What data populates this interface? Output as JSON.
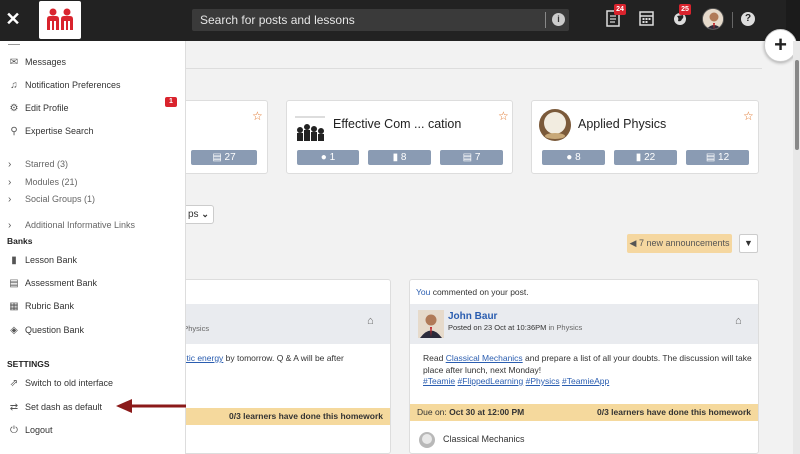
{
  "topbar": {
    "close_icon": "close-icon",
    "search_placeholder": "Search for posts and lessons",
    "notif_badge_1": "24",
    "notif_badge_2": "25",
    "help_glyph": "?"
  },
  "sidebar": {
    "items_top": [
      {
        "label": "Messages",
        "icon": "envelope-icon",
        "badge": "1"
      },
      {
        "label": "Notification Preferences",
        "icon": "bell-icon"
      },
      {
        "label": "Edit Profile",
        "icon": "gear-icon"
      },
      {
        "label": "Expertise Search",
        "icon": "search-icon"
      }
    ],
    "collapsibles": [
      {
        "label": "Starred (3)"
      },
      {
        "label": "Modules (21)"
      },
      {
        "label": "Social Groups (1)"
      },
      {
        "label": "Additional Informative Links"
      }
    ],
    "banks_heading": "Banks",
    "banks": [
      {
        "label": "Lesson Bank",
        "icon": "book-icon"
      },
      {
        "label": "Assessment Bank",
        "icon": "assessment-icon"
      },
      {
        "label": "Rubric Bank",
        "icon": "rubric-icon"
      },
      {
        "label": "Question Bank",
        "icon": "tag-icon"
      }
    ],
    "settings_heading": "SETTINGS",
    "settings": [
      {
        "label": "Switch to old interface",
        "icon": "external-link-icon"
      },
      {
        "label": "Set dash as default",
        "icon": "swap-icon"
      },
      {
        "label": "Logout",
        "icon": "power-icon"
      }
    ]
  },
  "courses": [
    {
      "title": "",
      "stats": [
        "27"
      ]
    },
    {
      "title": "Effective Com ... cation",
      "stats": [
        "1",
        "8",
        "7"
      ]
    },
    {
      "title": "Applied Physics",
      "stats": [
        "8",
        "22",
        "12"
      ]
    }
  ],
  "groups_button": "ps",
  "announcements": "7 new announcements",
  "post_left": {
    "subtitle_tail": "n Physics",
    "body_link": "netic energy",
    "body_rest": " by tomorrow. Q & A will be after",
    "footer": "0/3 learners have done this homework"
  },
  "post_right": {
    "top_you": "You",
    "top_rest": " commented on your post.",
    "author": "John Baur",
    "posted_prefix": "Posted on 23 Oct at 10:36PM ",
    "posted_in": "in Physics",
    "body_prefix": "Read ",
    "body_link": "Classical Mechanics",
    "body_rest": " and prepare a list of all your doubts. The discussion will take place after lunch, next Monday!",
    "hashtags": [
      "#Teamie",
      "#FlippedLearning",
      "#Physics",
      "#TeamieApp"
    ],
    "due_prefix": "Due on: ",
    "due_date": "Oct 30 at 12:00 PM",
    "footer": "0/3 learners have done this homework",
    "attachment": "Classical Mechanics"
  },
  "colors": {
    "topbar": "#222222",
    "badge": "#d9232d",
    "stat": "#8a9bb3",
    "footer": "#f5d99d",
    "link": "#2a5db0",
    "arrow": "#8b1a1a"
  }
}
